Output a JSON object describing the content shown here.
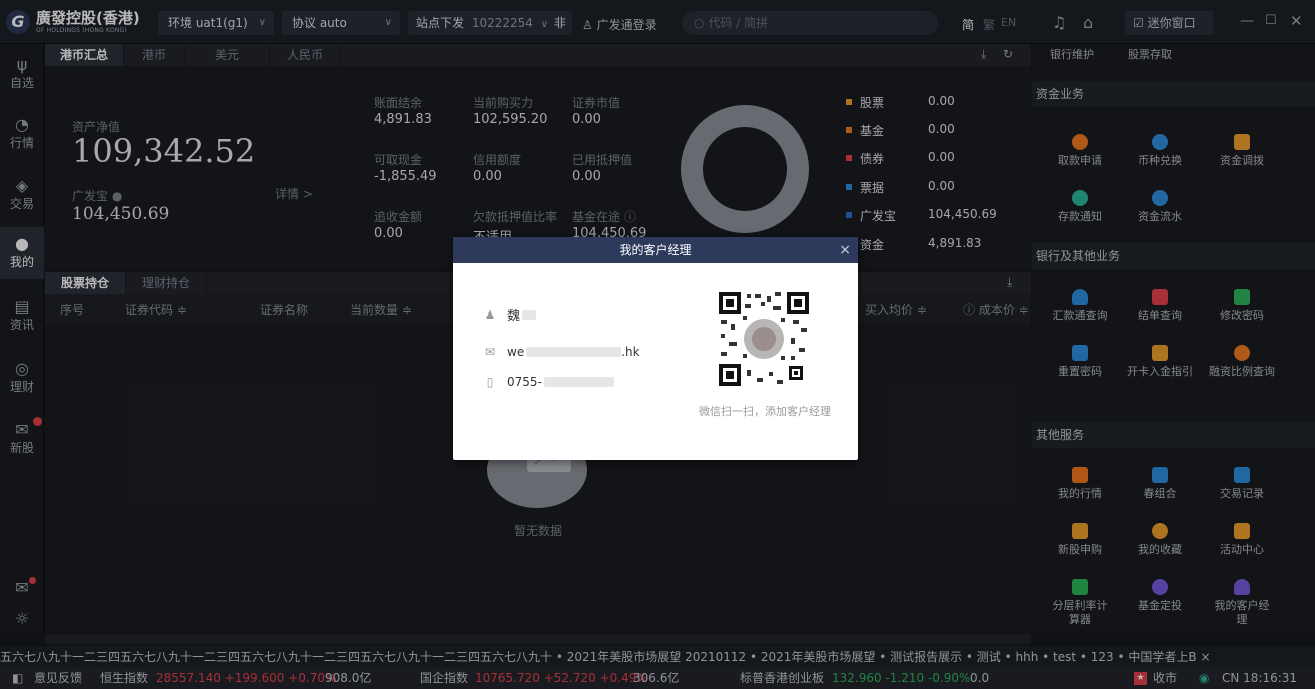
{
  "topbar": {
    "logo_cn": "廣發控股(香港)",
    "logo_en": "GF HOLDINGS (HONG KONG)",
    "env_label": "环境 uat1(g1)",
    "protocol_label": "协议 auto",
    "station_label": "站点下发",
    "station_value": "10222254",
    "station_suffix": "非",
    "login_label": "广发通登录",
    "search_placeholder": "代码 / 简拼",
    "lang_simplified": "简",
    "lang_traditional": "繁",
    "lang_en": "EN",
    "mini_window_label": "迷你窗口"
  },
  "leftnav": [
    {
      "label": "自选",
      "icon": "watchlist-icon"
    },
    {
      "label": "行情",
      "icon": "market-icon"
    },
    {
      "label": "交易",
      "icon": "trade-icon"
    },
    {
      "label": "我的",
      "icon": "user-icon",
      "active": true
    },
    {
      "label": "资讯",
      "icon": "news-icon"
    },
    {
      "label": "理财",
      "icon": "wealth-icon"
    },
    {
      "label": "新股",
      "icon": "ipo-icon"
    }
  ],
  "summary": {
    "tabs": [
      "港币汇总",
      "港币",
      "美元",
      "人民币"
    ],
    "net_asset_label": "资产净值",
    "net_asset_value": "109,342.52",
    "gft_label": "广发宝",
    "gft_value": "104,450.69",
    "detail_label": "详情 >",
    "metrics": [
      {
        "label": "账面结余",
        "value": "4,891.83"
      },
      {
        "label": "当前购买力",
        "value": "102,595.20"
      },
      {
        "label": "证券市值",
        "value": "0.00"
      },
      {
        "label": "可取现金",
        "value": "-1,855.49"
      },
      {
        "label": "信用额度",
        "value": "0.00"
      },
      {
        "label": "已用抵押值",
        "value": "0.00"
      },
      {
        "label": "追收金额",
        "value": "0.00"
      },
      {
        "label": "欠款抵押值比率",
        "value": "不适用"
      },
      {
        "label": "基金在途",
        "value": "104,450.69"
      }
    ],
    "legend": [
      {
        "label": "股票",
        "value": "0.00",
        "color": "#f0a32b"
      },
      {
        "label": "基金",
        "value": "0.00",
        "color": "#f47b20"
      },
      {
        "label": "债券",
        "value": "0.00",
        "color": "#e8434c"
      },
      {
        "label": "票据",
        "value": "0.00",
        "color": "#2f8fe0"
      },
      {
        "label": "广发宝",
        "value": "104,450.69",
        "color": "#2f6fd0"
      },
      {
        "label": "资金",
        "value": "4,891.83",
        "color": "#3aa0e0"
      }
    ]
  },
  "holdings": {
    "tabs": [
      "股票持仓",
      "理财持仓"
    ],
    "columns": [
      "序号",
      "证券代码 ≑",
      "证券名称",
      "当前数量 ≑",
      "买入均价 ≑",
      "成本价 ≑"
    ],
    "empty_text": "暂无数据"
  },
  "right": {
    "top_links": [
      "银行维护",
      "股票存取"
    ],
    "sections": [
      {
        "title": "资金业务",
        "items": [
          {
            "label": "取款申请",
            "color": "#f47b20"
          },
          {
            "label": "币种兑换",
            "color": "#2f8fe0"
          },
          {
            "label": "资金调拨",
            "color": "#f0a32b"
          },
          {
            "label": "存款通知",
            "color": "#2fb89a"
          },
          {
            "label": "资金流水",
            "color": "#2f8fe0"
          }
        ]
      },
      {
        "title": "银行及其他业务",
        "items": [
          {
            "label": "汇款通查询",
            "color": "#2f8fe0"
          },
          {
            "label": "结单查询",
            "color": "#e8434c"
          },
          {
            "label": "修改密码",
            "color": "#2fb85a"
          },
          {
            "label": "重置密码",
            "color": "#2f8fe0"
          },
          {
            "label": "开卡入金指引",
            "color": "#f0a32b"
          },
          {
            "label": "融资比例查询",
            "color": "#f47b20"
          }
        ]
      },
      {
        "title": "其他服务",
        "items": [
          {
            "label": "我的行情",
            "color": "#f47b20"
          },
          {
            "label": "春组合",
            "color": "#2f8fe0"
          },
          {
            "label": "交易记录",
            "color": "#2f8fe0"
          },
          {
            "label": "新股申购",
            "color": "#f0a32b"
          },
          {
            "label": "我的收藏",
            "color": "#f0a32b"
          },
          {
            "label": "活动中心",
            "color": "#f0a32b"
          },
          {
            "label": "分层利率计算器",
            "color": "#2fb85a"
          },
          {
            "label": "基金定投",
            "color": "#7b5ce0"
          },
          {
            "label": "我的客户经理",
            "color": "#7b5ce0"
          }
        ]
      }
    ]
  },
  "ticker": "五六七八九十一二三四五六七八九十一二三四五六七八九十一二三四五六七八九十一二三四五六七八九十  • 2021年美股市场展望 20210112  • 2021年美股市场展望  • 测试报告展示  • 测试  • hhh  • test  • 123  • 中国学者上B ×",
  "statusbar": {
    "feedback": "意见反馈",
    "index1_name": "恒生指数",
    "index1_values": "28557.140 +199.600 +0.70%",
    "index1_turnover": "908.0亿",
    "index2_name": "国企指数",
    "index2_values": "10765.720 +52.720 +0.49%",
    "index2_turnover": "306.6亿",
    "index3_name": "标普香港创业板",
    "index3_values": "132.960 -1.210 -0.90%",
    "index3_turnover": "0.0",
    "market_status": "收市",
    "clock": "CN 18:16:31"
  },
  "modal": {
    "title": "我的客户经理",
    "name": "魏",
    "email_prefix": "we",
    "email_suffix": ".hk",
    "phone_prefix": "0755-",
    "qr_caption": "微信扫一扫，添加客户经理"
  }
}
